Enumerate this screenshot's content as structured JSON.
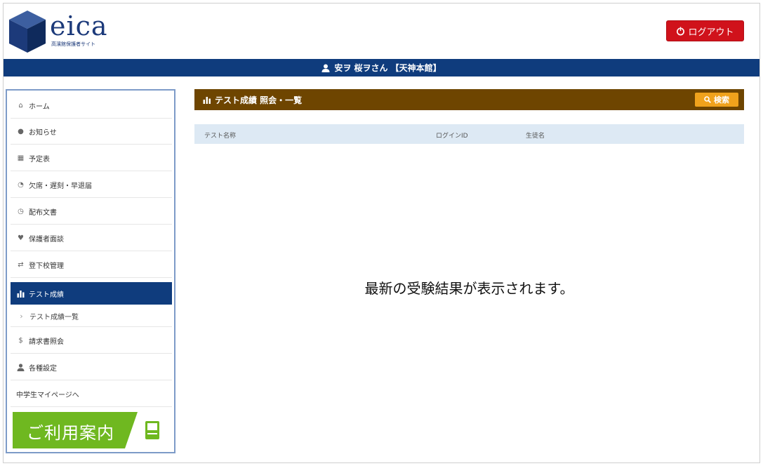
{
  "header": {
    "logo_text": "eica",
    "logo_subtitle": "高濱館保護者サイト",
    "logout_label": "ログアウト"
  },
  "user_bar": {
    "user_name": "安ヲ 桜ヲさん 【天神本館】"
  },
  "sidebar": {
    "items": [
      {
        "label": "ホーム",
        "icon": "home-icon"
      },
      {
        "label": "お知らせ",
        "icon": "info-icon"
      },
      {
        "label": "予定表",
        "icon": "calendar-icon"
      },
      {
        "label": "欠席・遅刻・早退届",
        "icon": "form-icon"
      },
      {
        "label": "配布文書",
        "icon": "document-icon"
      },
      {
        "label": "保護者面談",
        "icon": "heart-icon"
      },
      {
        "label": "登下校管理",
        "icon": "swap-icon"
      },
      {
        "label": "テスト成績",
        "icon": "bar-chart-icon"
      },
      {
        "label": "テスト成績一覧",
        "icon": "chevron-right-icon"
      },
      {
        "label": "請求書照会",
        "icon": "dollar-icon"
      },
      {
        "label": "各種設定",
        "icon": "user-icon"
      },
      {
        "label": "中学生マイページへ",
        "icon": ""
      }
    ],
    "guide_banner_label": "ご利用案内"
  },
  "main": {
    "panel_title": "テスト成績 照会・一覧",
    "search_label": "検索",
    "table_columns": [
      "テスト名称",
      "ログインID",
      "生徒名"
    ],
    "empty_message": "最新の受験結果が表示されます。"
  },
  "colors": {
    "brand_navy": "#0f3c7d",
    "logout_red": "#d0121b",
    "panel_brown": "#6e4500",
    "search_orange": "#f0a21c",
    "guide_green": "#6fb820",
    "table_header_bg": "#dde9f4"
  }
}
